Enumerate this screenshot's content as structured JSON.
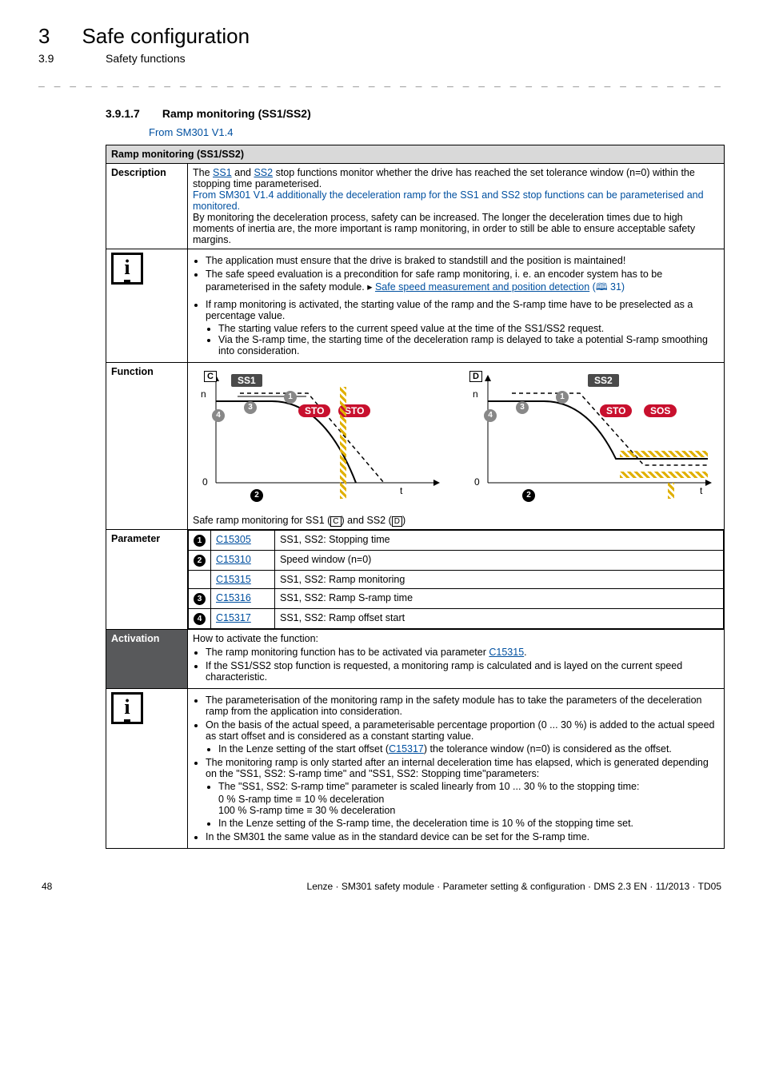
{
  "header": {
    "chapter_num": "3",
    "chapter_title": "Safe configuration",
    "section_num": "3.9",
    "section_title": "Safety functions",
    "sub_num": "3.9.1.7",
    "sub_title": "Ramp monitoring (SS1/SS2)",
    "version_note": "From SM301 V1.4"
  },
  "table": {
    "title": "Ramp monitoring (SS1/SS2)",
    "description": {
      "label": "Description",
      "p1a": "The ",
      "ss1_link": "SS1",
      "p1b": " and ",
      "ss2_link": "SS2",
      "p1c": " stop functions monitor whether the drive has reached the set tolerance window (n=0) within the stopping time parameterised.",
      "p2": "From SM301 V1.4 additionally the deceleration ramp for the SS1 and SS2 stop functions can be parameterised and monitored.",
      "p3": "By monitoring the deceleration process, safety can be increased. The longer the deceleration times due to high moments of inertia are, the more important is ramp monitoring, in order to still be able to ensure acceptable safety margins."
    },
    "info1": {
      "b1": "The application must ensure that the drive is braked to standstill and the position is maintained!",
      "b2a": "The safe speed evaluation is a precondition for safe ramp monitoring, i. e. an encoder system has to be parameterised in the safety module. ▸ ",
      "b2link": "Safe speed measurement and position detection",
      "b2page": " (🕮 31)",
      "b3": "If ramp monitoring is activated, the starting value of the ramp and the S-ramp time have to be preselected as a percentage value.",
      "b3s1": "The starting value refers to the current speed value at the time of the SS1/SS2 request.",
      "b3s2": "Via the S-ramp time, the starting time of the deceleration ramp is delayed to take a potential S-ramp smoothing into consideration."
    },
    "function": {
      "label": "Function",
      "tagC": "C",
      "tagD": "D",
      "ss1": "SS1",
      "ss2": "SS2",
      "sto": "STO",
      "sos": "SOS",
      "n": "n",
      "zero": "0",
      "t": "t",
      "caption_a": "Safe ramp monitoring for SS1 (",
      "caption_c": "C",
      "caption_b": ") and SS2 (",
      "caption_d": "D",
      "caption_e": ")"
    },
    "parameter": {
      "label": "Parameter",
      "rows": [
        {
          "num": "1",
          "code": "C15305",
          "text": "SS1, SS2: Stopping time"
        },
        {
          "num": "2",
          "code": "C15310",
          "text": "Speed window (n=0)"
        },
        {
          "num": "",
          "code": "C15315",
          "text": "SS1, SS2: Ramp monitoring"
        },
        {
          "num": "3",
          "code": "C15316",
          "text": "SS1, SS2: Ramp S-ramp time"
        },
        {
          "num": "4",
          "code": "C15317",
          "text": "SS1, SS2: Ramp offset start"
        }
      ]
    },
    "activation": {
      "label": "Activation",
      "intro": "How to activate the function:",
      "a1a": "The ramp monitoring function has to be activated via parameter ",
      "a1link": "C15315",
      "a1b": ".",
      "a2": "If the SS1/SS2 stop function is requested, a monitoring ramp is calculated and is layed on the current speed characteristic."
    },
    "info2": {
      "b1": "The parameterisation of the monitoring ramp in the safety module has to take the parameters of the deceleration ramp from the application into consideration.",
      "b2a": "On the basis of the actual speed, a parameterisable percentage proportion (0 ... 30 %) is added to the actual speed as start offset and is considered as a constant starting value.",
      "b2sa": "In the Lenze setting of the start offset (",
      "b2slink": "C15317",
      "b2sb": ") the tolerance window (n=0) is considered as the offset.",
      "b3": "The monitoring ramp is only started after an internal deceleration time has elapsed, which is generated depending on the \"SS1, SS2: S-ramp time\" and \"SS1, SS2: Stopping time\"parameters:",
      "b3s1": "The \"SS1, SS2: S-ramp time\" parameter is scaled linearly from 10 ... 30 % to the stopping time:",
      "line1": "0 % S-ramp time ≡ 10 % deceleration",
      "line2": "100 % S-ramp time ≡ 30 % deceleration",
      "b3s2": "In the Lenze setting of the S-ramp time, the deceleration time is 10 % of the stopping time set.",
      "b4": "In the SM301 the same value as in the standard device can be set for the S-ramp time."
    }
  },
  "footer": {
    "page": "48",
    "text": "Lenze · SM301 safety module · Parameter setting & configuration · DMS 2.3 EN · 11/2013 · TD05"
  }
}
